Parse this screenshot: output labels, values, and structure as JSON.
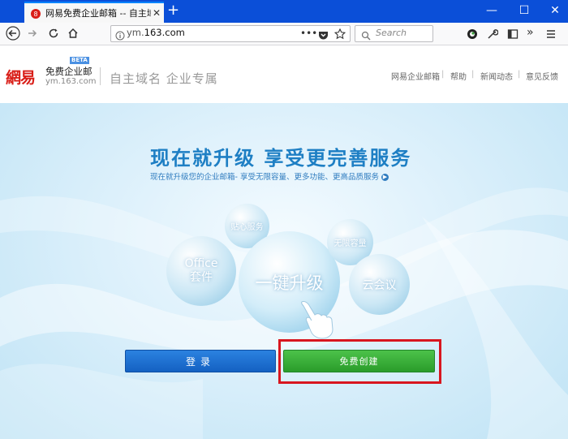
{
  "browser": {
    "tab_title": "网易免费企业邮箱 -- 自主域名",
    "url_prefix": "ym.",
    "url_domain": "163.com",
    "search_placeholder": "Search",
    "new_tab_symbol": "+",
    "tab_close_symbol": "✕",
    "window_minimize": "—",
    "window_maximize": "☐",
    "window_close": "✕",
    "accent_color": "#0b4fd8"
  },
  "header": {
    "logo_text": "網易",
    "product_name": "免费企业邮",
    "beta_badge": "BETA",
    "domain": "ym.163.com",
    "slogan": "自主域名 企业专属",
    "nav": [
      "网易企业邮箱",
      "帮助",
      "新闻动态",
      "意见反馈"
    ],
    "nav_separator": "|"
  },
  "hero": {
    "headline": "现在就升级 享受更完善服务",
    "subline": "现在就升级您的企业邮箱- 享受无限容量、更多功能、更高品质服务",
    "bubbles": {
      "service": "贴心服务",
      "office_line1": "Office",
      "office_line2": "套件",
      "upgrade": "一键升级",
      "storage": "无限容量",
      "meeting": "云会议"
    },
    "login_button": "登录",
    "create_button": "免费创建",
    "highlight_color": "#d8161f"
  }
}
